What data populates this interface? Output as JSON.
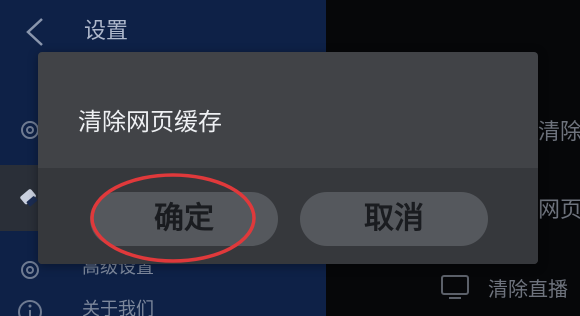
{
  "header": {
    "title": "设置"
  },
  "sidebar": {
    "items": [
      {
        "label": "",
        "icon": "gear-icon"
      },
      {
        "label": "",
        "icon": "brush-icon",
        "selected": true
      },
      {
        "label": "高级设置",
        "icon": "gear-icon"
      },
      {
        "label": "关于我们",
        "icon": "info-icon"
      }
    ]
  },
  "content": {
    "items": [
      {
        "label": "清除"
      },
      {
        "label": "网页"
      },
      {
        "label": "清除直播",
        "icon": "tv-icon"
      }
    ]
  },
  "dialog": {
    "title": "清除网页缓存",
    "confirm_label": "确定",
    "cancel_label": "取消"
  },
  "colors": {
    "annotation": "#e0393b",
    "left_panel": "#0e2147",
    "dialog": "#414347",
    "button": "#55585d"
  }
}
